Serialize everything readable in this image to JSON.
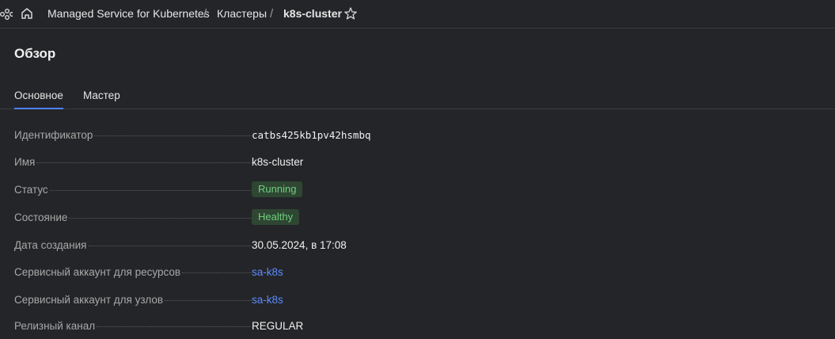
{
  "header": {
    "icons": [
      "services-icon",
      "home-icon",
      "star-icon"
    ],
    "breadcrumbs": [
      "Managed Service for Kubernetes",
      "Кластеры",
      "k8s-cluster"
    ],
    "separator": "/"
  },
  "page": {
    "title": "Обзор"
  },
  "tabs": [
    {
      "label": "Основное",
      "active": true
    },
    {
      "label": "Мастер",
      "active": false
    }
  ],
  "details": [
    {
      "key": "Идентификатор",
      "value": "catbs425kb1pv42hsmbq",
      "kind": "mono"
    },
    {
      "key": "Имя",
      "value": "k8s-cluster",
      "kind": "text"
    },
    {
      "key": "Статус",
      "value": "Running",
      "kind": "badge"
    },
    {
      "key": "Состояние",
      "value": "Healthy",
      "kind": "badge"
    },
    {
      "key": "Дата создания",
      "value": "30.05.2024, в 17:08",
      "kind": "text"
    },
    {
      "key": "Сервисный аккаунт для ресурсов",
      "value": "sa-k8s",
      "kind": "link"
    },
    {
      "key": "Сервисный аккаунт для узлов",
      "value": "sa-k8s",
      "kind": "link"
    },
    {
      "key": "Релизный канал",
      "value": "REGULAR",
      "kind": "text"
    }
  ],
  "colors": {
    "background": "#242528",
    "accent": "#5282ff",
    "link": "#5b8cff",
    "badge_bg": "#2e4632",
    "badge_text": "#6fcf7d"
  }
}
